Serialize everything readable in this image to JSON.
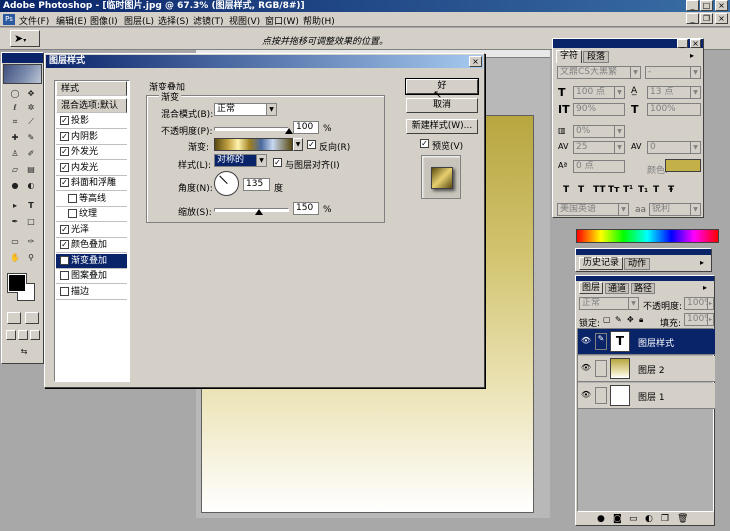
{
  "app": {
    "title": "Adobe Photoshop - [临时图片.jpg @ 67.3% (图层样式, RGB/8#)]",
    "menus": [
      "文件(F)",
      "编辑(E)",
      "图像(I)",
      "图层(L)",
      "选择(S)",
      "滤镜(T)",
      "视图(V)",
      "窗口(W)",
      "帮助(H)"
    ],
    "hint": "点按并拖移可调整效果的位置。"
  },
  "dialog": {
    "title": "图层样式",
    "styles_header": "样式",
    "blend_options": "混合选项:默认",
    "styles": [
      {
        "label": "投影",
        "checked": true
      },
      {
        "label": "内阴影",
        "checked": true
      },
      {
        "label": "外发光",
        "checked": true
      },
      {
        "label": "内发光",
        "checked": true
      },
      {
        "label": "斜面和浮雕",
        "checked": true
      },
      {
        "label": "等高线",
        "checked": false
      },
      {
        "label": "纹理",
        "checked": false
      },
      {
        "label": "光泽",
        "checked": true
      },
      {
        "label": "颜色叠加",
        "checked": true
      },
      {
        "label": "渐变叠加",
        "checked": true
      },
      {
        "label": "图案叠加",
        "checked": false
      },
      {
        "label": "描边",
        "checked": false
      }
    ],
    "section_title": "渐变叠加",
    "group_title": "渐变",
    "blend_mode_label": "混合模式(B):",
    "blend_mode_value": "正常",
    "opacity_label": "不透明度(P):",
    "opacity_value": "100",
    "opacity_level": 1.0,
    "percent": "%",
    "gradient_label": "渐变:",
    "reverse_label": "反向(R)",
    "style_label": "样式(L):",
    "style_value": "对称的",
    "align_label": "与图层对齐(I)",
    "angle_label": "角度(N):",
    "angle_value": "135",
    "angle_deg": 135,
    "degree": "度",
    "scale_label": "缩放(S):",
    "scale_value": "150",
    "scale_level": 0.6,
    "ok": "好",
    "cancel": "取消",
    "new_style": "新建样式(W)...",
    "preview_label": "预览(V)"
  },
  "char_panel": {
    "tabs": [
      "字符",
      "段落"
    ],
    "font": "文鼎CS大黑繁",
    "font_style": "-",
    "size": "100 点",
    "leading": "13 点",
    "vscale": "90%",
    "hscale": "100%",
    "tracking": "0%",
    "kerning": "25",
    "spacing": "0",
    "baseline": "0 点",
    "color_label": "颜色:",
    "color": "#c4b048",
    "format_buttons": [
      "T",
      "T",
      "TT",
      "Tт",
      "T¹",
      "T₁",
      "T",
      "Ŧ"
    ],
    "language": "美国英语",
    "aa_label": "aa",
    "aa_value": "锐利"
  },
  "history_panel": {
    "tabs": [
      "历史记录",
      "动作"
    ]
  },
  "layers_panel": {
    "tabs": [
      "图层",
      "通道",
      "路径"
    ],
    "blend": "正常",
    "opacity_label": "不透明度:",
    "opacity": "100%",
    "lock_label": "锁定:",
    "fill_label": "填充:",
    "fill": "100%",
    "layers": [
      {
        "name": "图层样式",
        "type": "text",
        "selected": true
      },
      {
        "name": "图层 2",
        "type": "gradient",
        "selected": false
      },
      {
        "name": "图层 1",
        "type": "white",
        "selected": false
      }
    ]
  },
  "colors": {
    "title_active": "#0a246a",
    "title_inactive": "#808080",
    "chrome": "#d4d0c8",
    "gold": "#c4b048"
  }
}
